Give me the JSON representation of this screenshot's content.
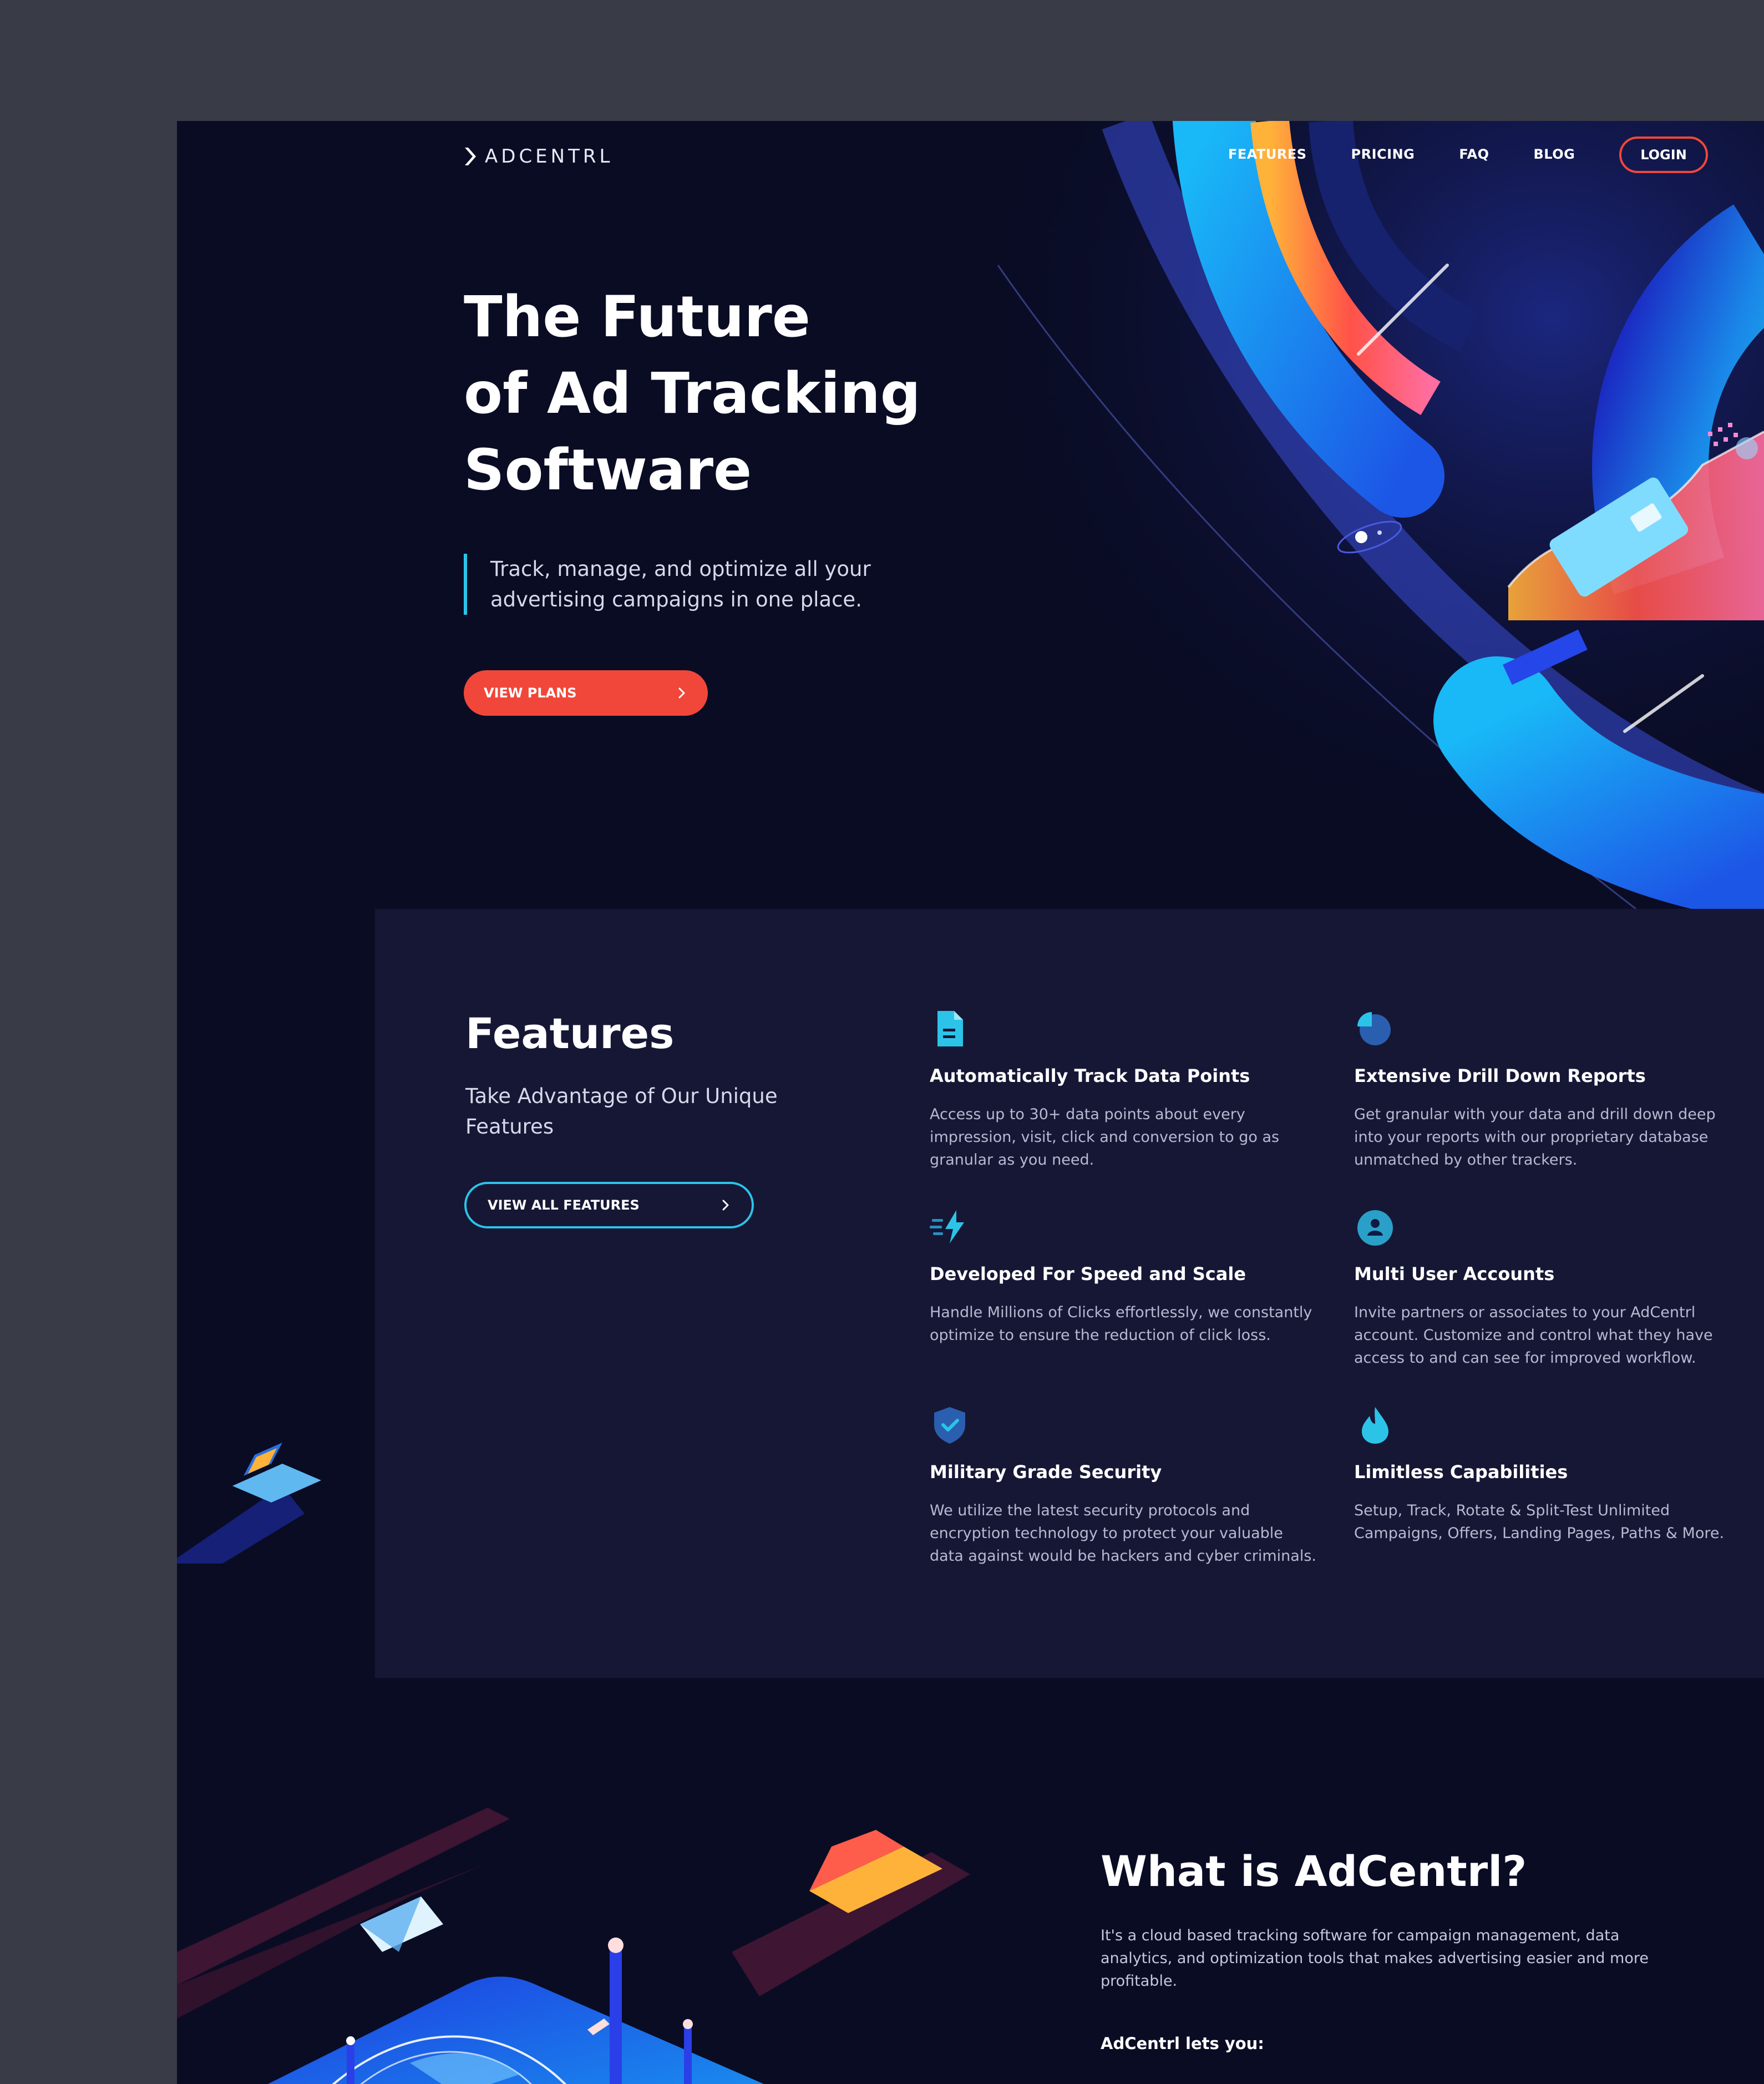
{
  "nav": {
    "logo_text": "ADCENTRL",
    "links": [
      "FEATURES",
      "PRICING",
      "FAQ",
      "BLOG"
    ],
    "login": "LOGIN"
  },
  "hero": {
    "title_lines": [
      "The Future",
      "of Ad Tracking",
      "Software"
    ],
    "subtitle_lines": [
      "Track, manage, and optimize all your",
      "advertising campaigns in one place."
    ],
    "cta": "VIEW PLANS"
  },
  "features": {
    "title": "Features",
    "subtitle": "Take Advantage of Our Unique Features",
    "cta": "VIEW ALL FEATURES",
    "items": [
      {
        "icon": "document-icon",
        "title": "Automatically Track Data Points",
        "text": "Access up to 30+ data points about every impression, visit, click and conversion to go as granular as you need."
      },
      {
        "icon": "pie-chart-icon",
        "title": "Extensive Drill Down Reports",
        "text": "Get granular with your data and drill down deep into your reports with our proprietary database unmatched by other trackers."
      },
      {
        "icon": "lightning-icon",
        "title": "Developed For Speed and Scale",
        "text": "Handle Millions of Clicks effortlessly, we constantly optimize to ensure the reduction of click loss."
      },
      {
        "icon": "user-icon",
        "title": "Multi User Accounts",
        "text": "Invite partners or associates to your AdCentrl account.  Customize and control what they have access to and can see for improved workflow."
      },
      {
        "icon": "shield-icon",
        "title": "Military Grade Security",
        "text": "We utilize the latest security protocols and encryption technology to protect your valuable data against would be hackers and cyber criminals."
      },
      {
        "icon": "flame-icon",
        "title": "Limitless Capabilities",
        "text": "Setup, Track, Rotate & Split-Test Unlimited Campaigns, Offers, Landing Pages, Paths & More."
      }
    ]
  },
  "what": {
    "title": "What is AdCentrl?",
    "description": "It's a cloud based tracking software for campaign management, data analytics, and optimization tools that makes advertising easier and more profitable.",
    "lets_you": "AdCentrl lets you:"
  },
  "colors": {
    "page_bg": "#393b47",
    "site_bg": "#0a0c24",
    "panel_bg": "#161735",
    "accent_red": "#f0473a",
    "accent_cyan": "#2bc4e8"
  }
}
